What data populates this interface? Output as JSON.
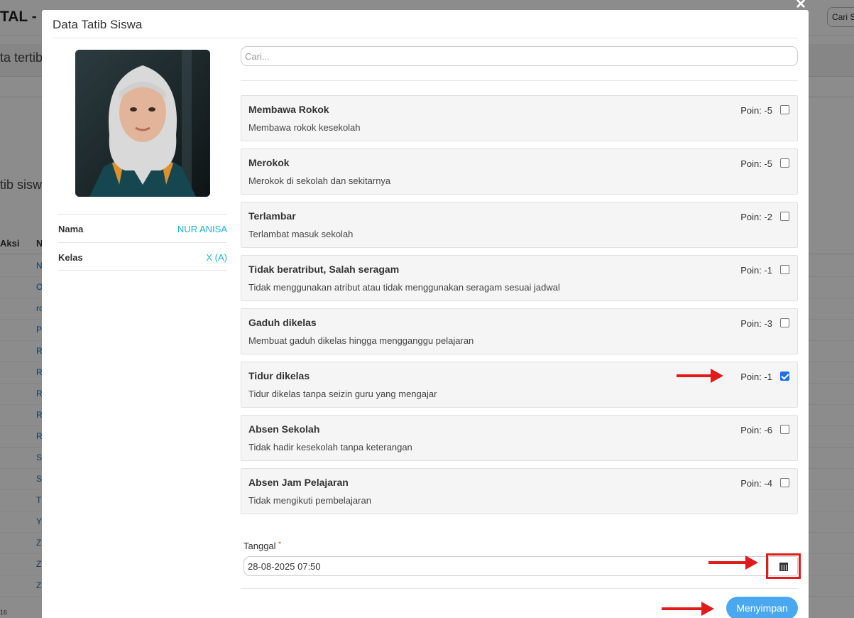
{
  "background": {
    "brand_text": "TAL -",
    "search_text": "Cari S",
    "subtitle": "ta tertib",
    "heading": "tib sisw",
    "col_aksi": "Aksi",
    "col_n": "N",
    "rows": [
      "N",
      "O",
      "ro",
      "P",
      "R",
      "R",
      "R",
      "R",
      "R",
      "S",
      "S",
      "T",
      "Y",
      "Z",
      "Z",
      "Z"
    ],
    "footer": "16"
  },
  "modal": {
    "title": "Data Tatib Siswa",
    "close_symbol": "×",
    "student": {
      "name_label": "Nama",
      "name_value": "NUR ANISA",
      "class_label": "Kelas",
      "class_value": "X (A)"
    },
    "search_placeholder": "Cari...",
    "items": [
      {
        "title": "Membawa Rokok",
        "desc": "Membawa rokok kesekolah",
        "poin": "Poin: -5",
        "checked": false
      },
      {
        "title": "Merokok",
        "desc": "Merokok di sekolah dan sekitarnya",
        "poin": "Poin: -5",
        "checked": false
      },
      {
        "title": "Terlambar",
        "desc": "Terlambat masuk sekolah",
        "poin": "Poin: -2",
        "checked": false
      },
      {
        "title": "Tidak beratribut, Salah seragam",
        "desc": "Tidak menggunakan atribut atau tidak menggunakan seragam sesuai jadwal",
        "poin": "Poin: -1",
        "checked": false
      },
      {
        "title": "Gaduh dikelas",
        "desc": "Membuat gaduh dikelas hingga mengganggu pelajaran",
        "poin": "Poin: -3",
        "checked": false
      },
      {
        "title": "Tidur dikelas",
        "desc": "Tidur dikelas tanpa seizin guru yang mengajar",
        "poin": "Poin: -1",
        "checked": true
      },
      {
        "title": "Absen Sekolah",
        "desc": "Tidak hadir kesekolah tanpa keterangan",
        "poin": "Poin: -6",
        "checked": false
      },
      {
        "title": "Absen Jam Pelajaran",
        "desc": "Tidak mengikuti pembelajaran",
        "poin": "Poin: -4",
        "checked": false
      }
    ],
    "date_label": "Tanggal",
    "date_required": "*",
    "date_value": "28-08-2025 07:50",
    "save_label": "Menyimpan"
  },
  "colors": {
    "accent": "#4aa8f0",
    "link": "#1ab1d6",
    "annotation": "#e01b1b",
    "checked": "#1a73e8"
  },
  "icons": {
    "calendar": "calendar-icon",
    "close": "close-icon"
  }
}
